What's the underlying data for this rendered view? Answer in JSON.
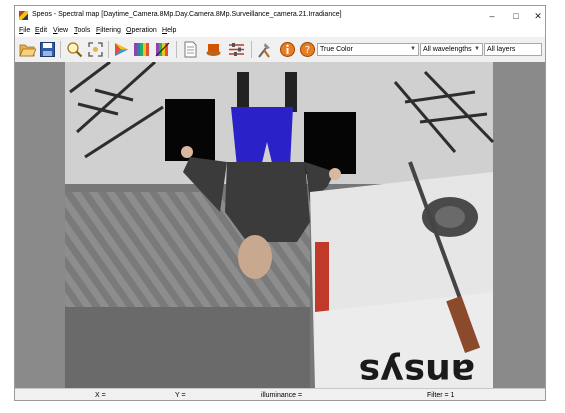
{
  "window": {
    "title": "Speos - Spectral map [Daytime_Camera.8Mp.Day.Camera.8Mp.Surveillance_camera.21.Irradiance]"
  },
  "menu": [
    "File",
    "Edit",
    "View",
    "Tools",
    "Filtering",
    "Operation",
    "Help"
  ],
  "toolbar": {
    "icons": [
      "open-icon",
      "save-icon",
      "zoom-icon",
      "zoom-fit-icon",
      "color-wheel-icon",
      "spectrum-icon",
      "spectrum-filter-icon",
      "document-icon",
      "layers-icon",
      "sliders-icon",
      "tools-icon",
      "info-icon",
      "help-icon"
    ],
    "color_mode": "True Color",
    "wavelength": "All wavelengths",
    "layers": "All layers"
  },
  "scene": {
    "sign_text": "ansys"
  },
  "status": {
    "x_label": "X =",
    "y_label": "Y =",
    "illuminance_label": "illuminance =",
    "filter_label": "Filter = 1"
  },
  "colors": {
    "pants": "#2a22c8",
    "sign_red": "#c0392b",
    "background": "#8a8a8a"
  }
}
